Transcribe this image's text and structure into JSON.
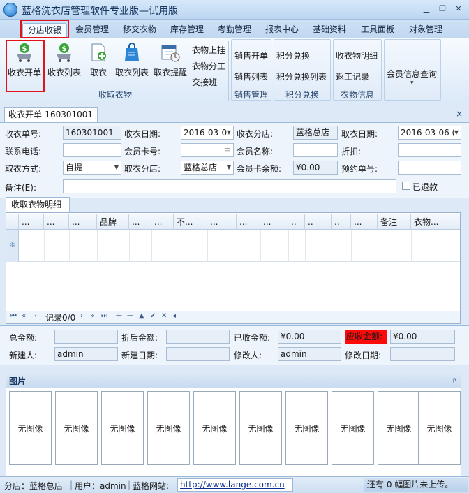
{
  "window": {
    "title": "蓝格洗衣店管理软件专业版—试用版",
    "minimize": "▁",
    "restore": "❐",
    "close": "✕"
  },
  "menu_tabs": [
    "分店收银",
    "会员管理",
    "移交衣物",
    "库存管理",
    "考勤管理",
    "报表中心",
    "基础资料",
    "工具面板",
    "对象管理"
  ],
  "ribbon": {
    "receive_group": {
      "label": "收取衣物",
      "buttons": [
        "收衣开单",
        "收衣列表",
        "取衣",
        "取衣列表",
        "取衣提醒"
      ],
      "links": [
        "衣物上挂",
        "衣物分工",
        "交接班"
      ]
    },
    "sales_group": {
      "label": "销售管理",
      "links": [
        "销售开单",
        "销售列表"
      ]
    },
    "points_group": {
      "label": "积分兑换",
      "links": [
        "积分兑换",
        "积分兑换列表"
      ]
    },
    "info_group": {
      "label": "衣物信息",
      "links": [
        "收衣物明细",
        "返工记录"
      ]
    },
    "member_query": {
      "label": "会员信息查询",
      "arrow": "▾"
    }
  },
  "document_tab": {
    "label": "收衣开单-160301001",
    "close": "×"
  },
  "form": {
    "order_no_label": "收衣单号:",
    "order_no": "160301001",
    "receive_date_label": "收衣日期:",
    "receive_date": "2016-03-0",
    "receive_branch_label": "收衣分店:",
    "receive_branch": "蓝格总店",
    "pickup_date_label": "取衣日期:",
    "pickup_date": "2016-03-06 (",
    "phone_label": "联系电话:",
    "phone": "",
    "card_label": "会员卡号:",
    "card": "",
    "member_name_label": "会员名称:",
    "member_name": "",
    "discount_label": "折扣:",
    "discount": "",
    "pickup_method_label": "取衣方式:",
    "pickup_method": "自提",
    "pickup_branch_label": "取衣分店:",
    "pickup_branch": "蓝格总店",
    "card_balance_label": "会员卡余额:",
    "card_balance": "¥0.00",
    "reservation_label": "预约单号:",
    "reservation": "",
    "remark_label": "备注(E):",
    "remark": "",
    "refunded_label": "已退款"
  },
  "detail_tab": "收取衣物明细",
  "grid": {
    "columns": [
      "...",
      "...",
      "...",
      "品牌",
      "...",
      "...",
      "不...",
      "...",
      "...",
      "...",
      "..",
      "..",
      "..",
      "...",
      "备注",
      "衣物..."
    ],
    "row_marker": "✻"
  },
  "navigator": {
    "buttons": [
      "⏮",
      "«",
      "‹"
    ],
    "record": "记录0/0",
    "buttons2": [
      "›",
      "»",
      "⏭",
      "+",
      "−",
      "▲",
      "✔",
      "✕",
      "◂"
    ]
  },
  "totals": {
    "total_label": "总金额:",
    "total": "",
    "after_discount_label": "折后金额:",
    "after_discount": "",
    "received_label": "已收金额:",
    "received": "¥0.00",
    "due_label": "应收金额:",
    "due": "¥0.00",
    "creator_label": "新建人:",
    "creator": "admin",
    "create_date_label": "新建日期:",
    "create_date": "",
    "modifier_label": "修改人:",
    "modifier": "admin",
    "modify_date_label": "修改日期:",
    "modify_date": ""
  },
  "images": {
    "title": "图片",
    "pin": "ᵖ",
    "placeholder": "无图像",
    "count": 10
  },
  "status": {
    "branch": "分店：蓝格总店",
    "user": "用户：admin",
    "site_label": "蓝格网站:",
    "url": "http://www.lange.com.cn",
    "upload": "还有 0 幅图片未上传。"
  },
  "colors": {
    "highlight": "#e0151a",
    "due_bg": "#ff0a0a"
  }
}
